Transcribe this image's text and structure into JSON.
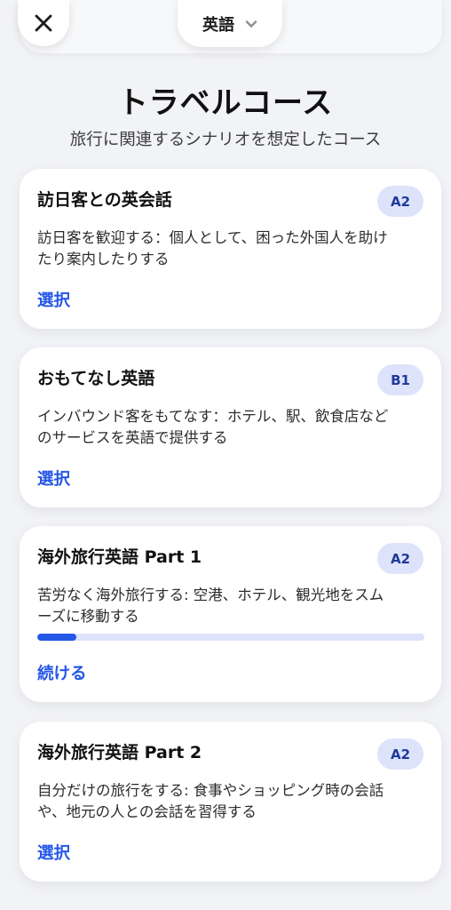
{
  "header": {
    "close_icon": "close-icon",
    "language": "英語",
    "language_chevron_icon": "chevron-down-icon"
  },
  "page": {
    "title": "トラベルコース",
    "subtitle": "旅行に関連するシナリオを想定したコース"
  },
  "colors": {
    "accent": "#2557e8",
    "badge_bg": "#dde3fb",
    "badge_text": "#1f3a99",
    "background": "#f2f3f7"
  },
  "courses": [
    {
      "title": "訪日客との英会話",
      "level": "A2",
      "desc_line1": "訪日客を歓迎する：個人として、困った外国人を助け",
      "desc_line2": "たり案内したりする",
      "action": "選択"
    },
    {
      "title": "おもてなし英語",
      "level": "B1",
      "desc_line1": "インバウンド客をもてなす：ホテル、駅、飲食店など",
      "desc_line2": "のサービスを英語で提供する",
      "action": "選択"
    },
    {
      "title": "海外旅行英語 Part 1",
      "level": "A2",
      "desc_line1": "苦労なく海外旅行する: 空港、ホテル、観光地をスム",
      "desc_line2": "ーズに移動する",
      "progress": 0.1,
      "action": "続ける"
    },
    {
      "title": "海外旅行英語 Part 2",
      "level": "A2",
      "desc_line1": "自分だけの旅行をする: 食事やショッピング時の会話",
      "desc_line2": "や、地元の人との会話を習得する",
      "action": "選択"
    }
  ]
}
